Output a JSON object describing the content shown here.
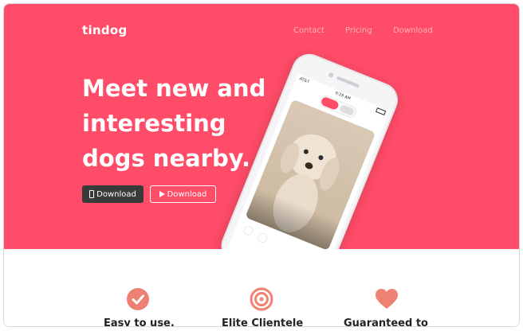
{
  "navbar": {
    "brand": "tindog",
    "links": [
      "Contact",
      "Pricing",
      "Download"
    ]
  },
  "hero": {
    "headline_lines": [
      "Meet new and",
      "interesting",
      "dogs nearby."
    ],
    "buttons": [
      {
        "label": "Download",
        "icon": "apple-icon"
      },
      {
        "label": "Download",
        "icon": "play-store-icon"
      }
    ]
  },
  "phone": {
    "carrier": "AT&T",
    "time": "9:28 AM"
  },
  "features": [
    {
      "title": "Easy to use.",
      "icon": "check-circle-icon"
    },
    {
      "title": "Elite Clientele",
      "icon": "target-icon"
    },
    {
      "title": "Guaranteed to",
      "icon": "heart-icon"
    }
  ],
  "colors": {
    "brand": "#ff4c68",
    "button_dark": "#3a3a3a",
    "icon_accent": "#ef8172"
  }
}
